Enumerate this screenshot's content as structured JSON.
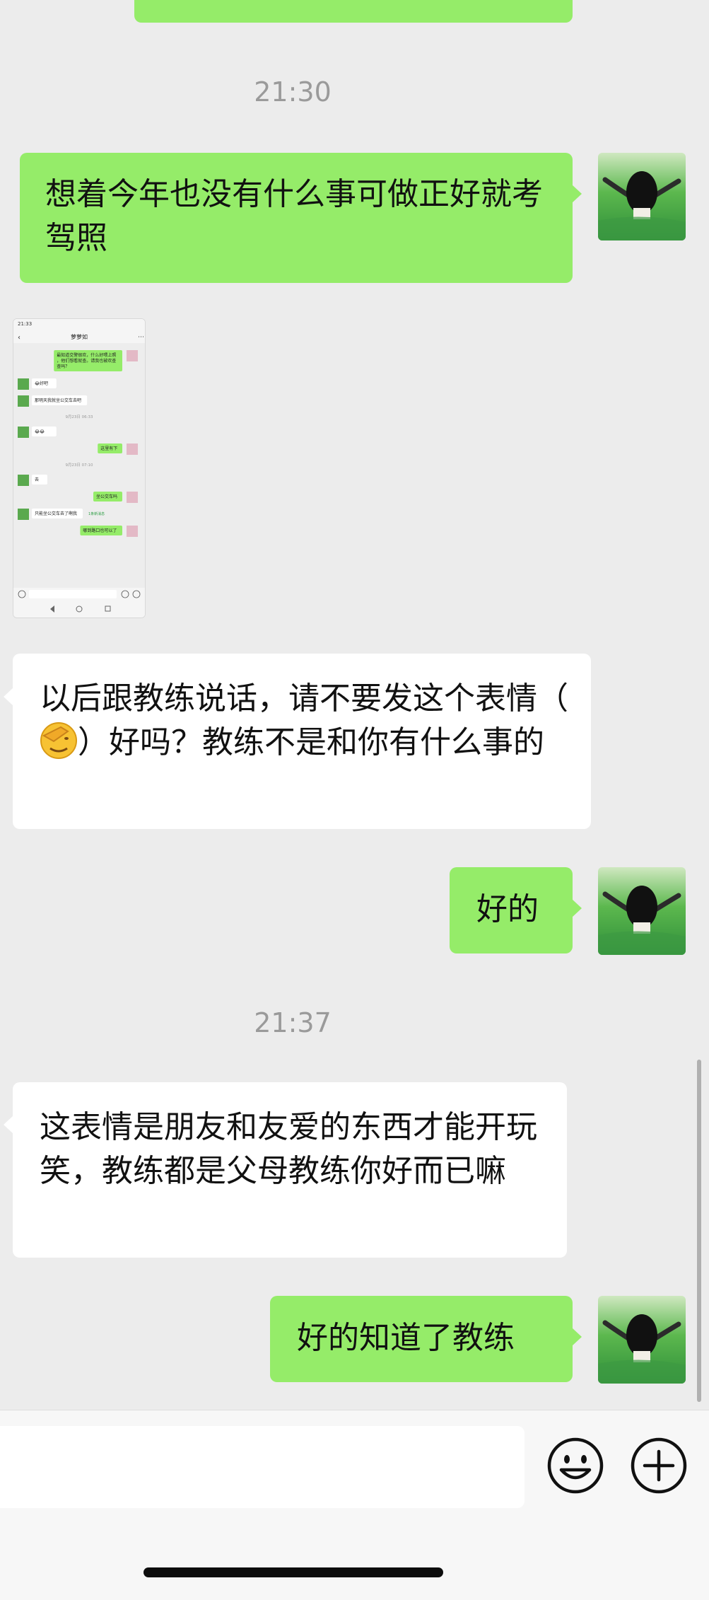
{
  "timestamps": [
    "21:30",
    "21:37"
  ],
  "messages": [
    {
      "side": "right",
      "text": "想着今年也没有什么事可做正好就考驾照"
    },
    {
      "side": "left",
      "text_before_emoji": "以后跟教练说话，请不要发这个表情（",
      "emoji": "facepalm-emoji",
      "text_after_emoji": "）好吗？教练不是和你有什么事的"
    },
    {
      "side": "right",
      "text": "好的"
    },
    {
      "side": "left",
      "text": "这表情是朋友和友爱的东西才能开玩笑，教练都是父母教练你好而已嘛"
    },
    {
      "side": "right",
      "text": "好的知道了教练"
    }
  ],
  "screenshot_attachment": {
    "status_time": "21:33",
    "title": "萝萝如",
    "messages": [
      {
        "side": "right",
        "text": "最知道交警很欢，什么好喂上照，他们想看就查。请我也被欢查查吗？"
      },
      {
        "side": "left",
        "text": "😂好吧"
      },
      {
        "side": "left",
        "text": "那明天我就坐公交车去吧"
      },
      {
        "side": "center",
        "text": "9月23日 06:33"
      },
      {
        "side": "left",
        "text": "😂😂"
      },
      {
        "side": "right",
        "text": "这里有下"
      },
      {
        "side": "center",
        "text": "9月23日 07:10"
      },
      {
        "side": "left",
        "text": "去"
      },
      {
        "side": "right",
        "text": "坐公交车吗"
      },
      {
        "side": "left",
        "text": "只能坐公交车去了啊我",
        "tag": "1条新消息"
      },
      {
        "side": "right",
        "text": "哪到路口也可以了"
      }
    ]
  },
  "input_bar": {
    "emoji_icon": "smiley-icon",
    "plus_icon": "plus-icon"
  },
  "colors": {
    "sent_bubble": "#95ec69",
    "received_bubble": "#ffffff",
    "background": "#ececec"
  }
}
